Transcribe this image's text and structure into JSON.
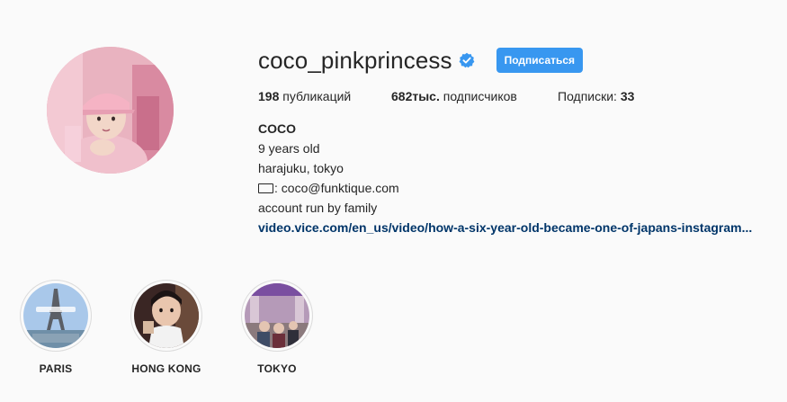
{
  "profile": {
    "username": "coco_pinkprincess",
    "verified": true,
    "follow_label": "Подписаться",
    "stats": {
      "posts_count": "198",
      "posts_label": "публикаций",
      "followers_count": "682тыс.",
      "followers_label": "подписчиков",
      "following_label": "Подписки:",
      "following_count": "33"
    },
    "bio": {
      "name": "COCO",
      "line1": "9 years old",
      "line2": "harajuku, tokyo",
      "email_line": ": coco@funktique.com",
      "line4": "account run by family",
      "link": "video.vice.com/en_us/video/how-a-six-year-old-became-one-of-japans-instagram..."
    }
  },
  "highlights": [
    {
      "label": "PARIS"
    },
    {
      "label": "HONG KONG"
    },
    {
      "label": "TOKYO"
    }
  ],
  "colors": {
    "accent": "#3897f0",
    "link": "#003569",
    "background": "#fafafa",
    "text": "#262626"
  },
  "icons": {
    "verified": "verified-badge-icon",
    "email": "envelope-icon"
  }
}
